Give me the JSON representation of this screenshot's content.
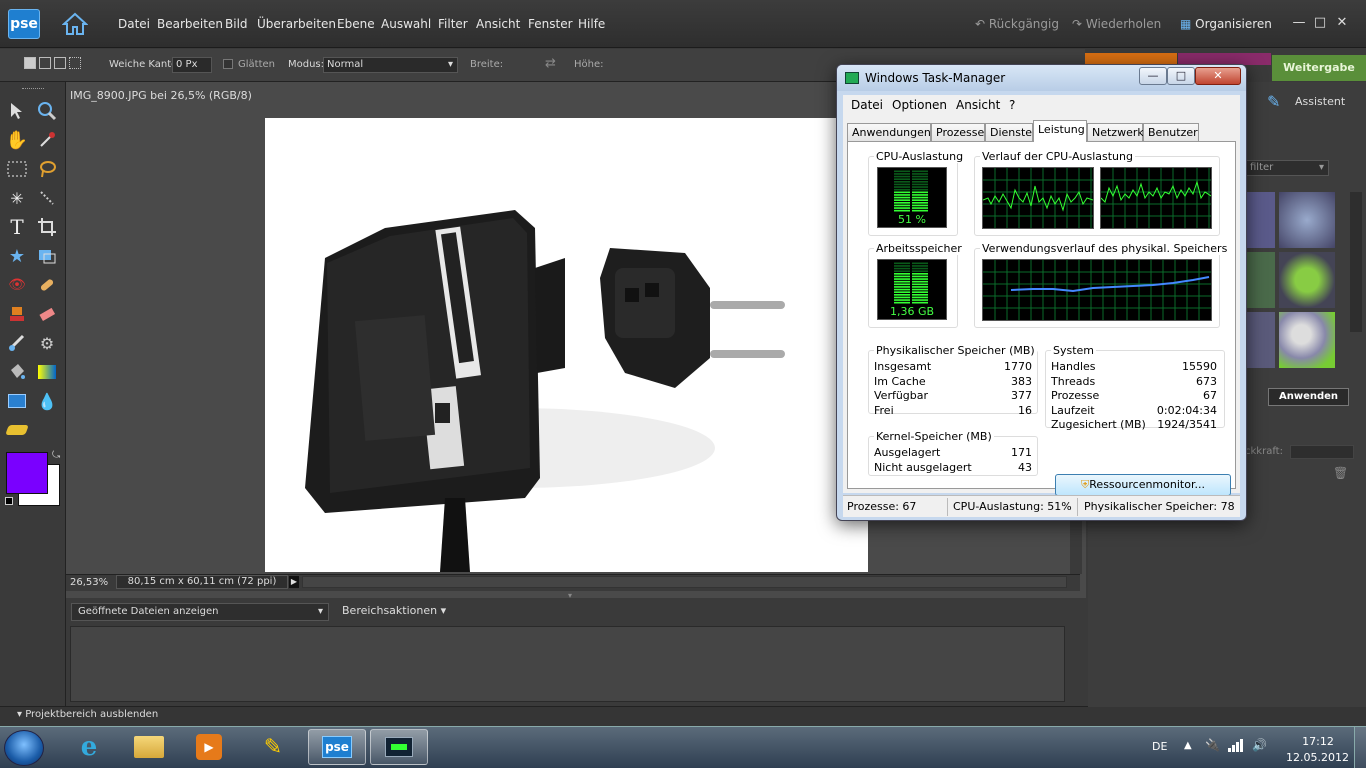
{
  "app": {
    "logo_text": "pse",
    "menu": [
      "Datei",
      "Bearbeiten",
      "Bild",
      "Überarbeiten",
      "Ebene",
      "Auswahl",
      "Filter",
      "Ansicht",
      "Fenster",
      "Hilfe"
    ],
    "undo_label": "Rückgängig",
    "redo_label": "Wiederholen",
    "organize_label": "Organisieren",
    "options": {
      "feather_label": "Weiche Kante:",
      "feather_value": "0 Px",
      "smooth_label": "Glätten",
      "mode_label": "Modus:",
      "mode_value": "Normal",
      "width_label": "Breite:",
      "height_label": "Höhe:"
    },
    "share_tab": "Weitergabe",
    "assistant_label": "Assistent",
    "filter_label": "filter",
    "opacity_label": "ckkraft:",
    "apply_button": "Anwenden",
    "doc_title": "IMG_8900.JPG bei 26,5% (RGB/8)",
    "zoom": "26,53%",
    "doc_size": "80,15 cm x 60,11 cm (72 ppi)",
    "bin_select": "Geöffnete Dateien anzeigen",
    "bin_actions": "Bereichsaktionen",
    "hide_bin": "Projektbereich ausblenden",
    "colors": {
      "foreground": "#7a00ff",
      "background": "#ffffff"
    }
  },
  "taskmgr": {
    "title": "Windows Task-Manager",
    "menu": [
      "Datei",
      "Optionen",
      "Ansicht",
      "?"
    ],
    "tabs": [
      "Anwendungen",
      "Prozesse",
      "Dienste",
      "Leistung",
      "Netzwerk",
      "Benutzer"
    ],
    "active_tab": "Leistung",
    "cpu_label": "CPU-Auslastung",
    "cpu_value": "51 %",
    "cpu_level": 0.51,
    "cpu_history_label": "Verlauf der CPU-Auslastung",
    "mem_label": "Arbeitsspeicher",
    "mem_value": "1,36 GB",
    "mem_level": 0.78,
    "mem_history_label": "Verwendungsverlauf des physikal. Speichers",
    "phys_title": "Physikalischer Speicher (MB)",
    "phys": [
      {
        "label": "Insgesamt",
        "value": "1770"
      },
      {
        "label": "Im Cache",
        "value": "383"
      },
      {
        "label": "Verfügbar",
        "value": "377"
      },
      {
        "label": "Frei",
        "value": "16"
      }
    ],
    "kernel_title": "Kernel-Speicher (MB)",
    "kernel": [
      {
        "label": "Ausgelagert",
        "value": "171"
      },
      {
        "label": "Nicht ausgelagert",
        "value": "43"
      }
    ],
    "system_title": "System",
    "system": [
      {
        "label": "Handles",
        "value": "15590"
      },
      {
        "label": "Threads",
        "value": "673"
      },
      {
        "label": "Prozesse",
        "value": "67"
      },
      {
        "label": "Laufzeit",
        "value": "0:02:04:34"
      },
      {
        "label": "Zugesichert (MB)",
        "value": "1924/3541"
      }
    ],
    "resource_button": "Ressourcenmonitor...",
    "status": {
      "processes": "Prozesse: 67",
      "cpu": "CPU-Auslastung: 51%",
      "memory": "Physikalischer Speicher: 78"
    }
  },
  "taskbar": {
    "lang": "DE",
    "time": "17:12",
    "date": "12.05.2012"
  }
}
